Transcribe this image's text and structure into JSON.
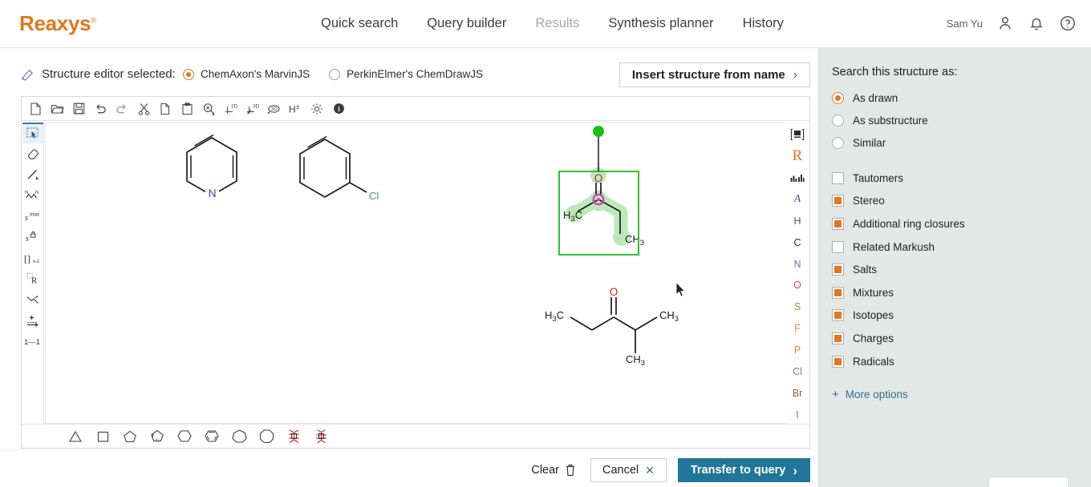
{
  "brand": {
    "name": "Reaxys",
    "trademark": "®",
    "color": "#e1761c"
  },
  "topnav": {
    "links": [
      {
        "label": "Quick search",
        "state": "enabled"
      },
      {
        "label": "Query builder",
        "state": "enabled"
      },
      {
        "label": "Results",
        "state": "disabled"
      },
      {
        "label": "Synthesis planner",
        "state": "enabled"
      },
      {
        "label": "History",
        "state": "enabled"
      }
    ],
    "user_name": "Sam Yu",
    "icons": [
      "user-icon",
      "bell-icon",
      "help-icon"
    ]
  },
  "editor_header": {
    "icon": "pencil-icon",
    "title": "Structure editor selected:",
    "options": [
      {
        "label": "ChemAxon's MarvinJS",
        "selected": true
      },
      {
        "label": "PerkinElmer's ChemDrawJS",
        "selected": false
      }
    ],
    "insert_button": {
      "label": "Insert structure from name",
      "chevron": "›"
    }
  },
  "editor": {
    "toolbar": [
      {
        "name": "new-file-icon",
        "title": "New"
      },
      {
        "name": "open-file-icon",
        "title": "Open"
      },
      {
        "name": "save-icon",
        "title": "Save"
      },
      {
        "name": "undo-icon",
        "title": "Undo"
      },
      {
        "name": "redo-icon",
        "title": "Redo"
      },
      {
        "name": "cut-icon",
        "title": "Cut"
      },
      {
        "name": "copy-icon",
        "title": "Copy"
      },
      {
        "name": "paste-icon",
        "title": "Paste"
      },
      {
        "name": "zoom-icon",
        "title": "Zoom"
      },
      {
        "name": "clean-2d-icon",
        "title": "Clean 2D"
      },
      {
        "name": "clean-3d-icon",
        "title": "Clean 3D"
      },
      {
        "name": "rotate-3d-icon",
        "title": "3D Rotate"
      },
      {
        "name": "hydrogen-icon",
        "title": "Add/Remove Hydrogens"
      },
      {
        "name": "settings-gear-icon",
        "title": "Settings"
      },
      {
        "name": "info-icon",
        "title": "About"
      }
    ],
    "left_tools": [
      {
        "name": "select-rectangle-tool",
        "label": "",
        "active": true
      },
      {
        "name": "eraser-tool",
        "label": "",
        "active": false
      },
      {
        "name": "bond-tool",
        "label": "",
        "active": false
      },
      {
        "name": "chain-tool",
        "label": "",
        "active": false
      },
      {
        "name": "s-max-tool",
        "label": "Smax",
        "active": false
      },
      {
        "name": "s-lock-tool",
        "label": "S",
        "active": false
      },
      {
        "name": "bracket-tool",
        "label": "[]x-z",
        "active": false
      },
      {
        "name": "r-group-tool",
        "label": "R",
        "active": false
      },
      {
        "name": "reaction-mapping-tool",
        "label": "",
        "active": false
      },
      {
        "name": "reaction-arrow-tool",
        "label": "",
        "active": false
      },
      {
        "name": "atom-map-tool",
        "label": "1→1",
        "active": false
      }
    ],
    "right_tools": [
      {
        "name": "periodic-table-icon",
        "label": "",
        "color": "#3c3c3c"
      },
      {
        "name": "r-group-label",
        "label": "R",
        "color": "#e1761c"
      },
      {
        "name": "atom-list-icon",
        "label": "",
        "color": "#3c3c3c"
      },
      {
        "name": "any-atom-label",
        "label": "A",
        "color": "#3b58a8"
      },
      {
        "name": "element-h",
        "label": "H",
        "color": "#555555"
      },
      {
        "name": "element-c",
        "label": "C",
        "color": "#2a2a2a"
      },
      {
        "name": "element-n",
        "label": "N",
        "color": "#6a6fc0"
      },
      {
        "name": "element-o",
        "label": "O",
        "color": "#cc4444"
      },
      {
        "name": "element-s",
        "label": "S",
        "color": "#9a8a33"
      },
      {
        "name": "element-f",
        "label": "F",
        "color": "#d08a3a"
      },
      {
        "name": "element-p",
        "label": "P",
        "color": "#d08a3a"
      },
      {
        "name": "element-cl",
        "label": "Cl",
        "color": "#44a05a"
      },
      {
        "name": "element-br",
        "label": "Br",
        "color": "#8a5a44"
      },
      {
        "name": "element-i",
        "label": "I",
        "color": "#9a5ab0"
      }
    ],
    "templates": [
      {
        "name": "template-cyclopropane",
        "shape": "triangle"
      },
      {
        "name": "template-cyclobutane",
        "shape": "square"
      },
      {
        "name": "template-cyclopentane",
        "shape": "pentagon"
      },
      {
        "name": "template-pyrrole",
        "shape": "pentagon-n"
      },
      {
        "name": "template-cyclohexane",
        "shape": "hexagon"
      },
      {
        "name": "template-benzene",
        "shape": "hexagon-aromatic"
      },
      {
        "name": "template-cycloheptane",
        "shape": "heptagon"
      },
      {
        "name": "template-cyclooctane",
        "shape": "octagon"
      },
      {
        "name": "template-custom-1",
        "shape": "star-red"
      },
      {
        "name": "template-custom-2",
        "shape": "star-red-2"
      }
    ],
    "structures": [
      {
        "name": "pyridine",
        "atom_labels": [
          {
            "text": "N",
            "color": "#3b3bd0"
          }
        ],
        "selected": false
      },
      {
        "name": "chlorobenzene",
        "atom_labels": [
          {
            "text": "Cl",
            "color": "#2fa84f"
          }
        ],
        "selected": false
      },
      {
        "name": "butan-2-one",
        "atom_labels": [
          {
            "text": "O",
            "color": "#cc2222"
          },
          {
            "text": "H3C",
            "color": "#1a1a1a"
          },
          {
            "text": "CH3",
            "color": "#1a1a1a"
          }
        ],
        "selected": true,
        "selection_color": "#2fc22f",
        "rotation_handle_color": "#16c016",
        "center_marker_color": "#d645b0"
      },
      {
        "name": "2-methylpentan-3-one",
        "atom_labels": [
          {
            "text": "O",
            "color": "#cc2222"
          },
          {
            "text": "H3C",
            "color": "#1a1a1a"
          },
          {
            "text": "CH3",
            "color": "#1a1a1a"
          },
          {
            "text": "CH3",
            "color": "#1a1a1a"
          }
        ],
        "selected": false
      }
    ]
  },
  "sidebar": {
    "title": "Search this structure as:",
    "search_modes": [
      {
        "label": "As drawn",
        "selected": true
      },
      {
        "label": "As substructure",
        "selected": false
      },
      {
        "label": "Similar",
        "selected": false
      }
    ],
    "checkboxes": [
      {
        "label": "Tautomers",
        "checked": false
      },
      {
        "label": "Stereo",
        "checked": true
      },
      {
        "label": "Additional ring closures",
        "checked": true
      },
      {
        "label": "Related Markush",
        "checked": false
      },
      {
        "label": "Salts",
        "checked": true
      },
      {
        "label": "Mixtures",
        "checked": true
      },
      {
        "label": "Isotopes",
        "checked": true
      },
      {
        "label": "Charges",
        "checked": true
      },
      {
        "label": "Radicals",
        "checked": true
      }
    ],
    "more_options": {
      "plus": "+",
      "label": "More options"
    },
    "accent_color": "#e1761c",
    "link_color": "#2e6e8e"
  },
  "bottom_bar": {
    "clear": {
      "label": "Clear",
      "icon": "trash-icon"
    },
    "cancel": {
      "label": "Cancel",
      "icon": "close-x-icon"
    },
    "transfer": {
      "label": "Transfer to query",
      "chevron": "›",
      "color": "#1f7699"
    }
  }
}
